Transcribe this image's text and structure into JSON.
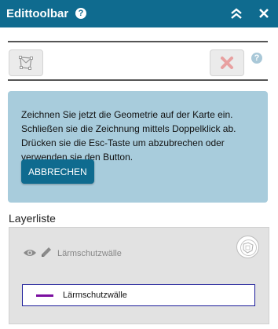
{
  "titlebar": {
    "title": "Edittoolbar",
    "help_glyph": "?",
    "collapse_icon": "double-chevron-up-icon",
    "close_icon": "close-icon"
  },
  "toolbar": {
    "draw_tool_icon": "polygon-draw-icon",
    "cancel_tool_icon": "red-x-icon",
    "help_glyph": "?"
  },
  "info": {
    "text": "Zeichnen Sie jetzt die Geometrie auf der Karte ein. Schließen sie die Zeichnung mittels Doppelklick ab. Drücken sie die Esc-Taste um abzubrechen oder verwenden sie den Button.",
    "button_label": "ABBRECHEN"
  },
  "layers": {
    "heading": "Layerliste",
    "items": [
      {
        "name": "Lärmschutzwälle",
        "legend_label": "Lärmschutzwälle",
        "legend_color": "#7b0fa0"
      }
    ]
  },
  "colors": {
    "accent": "#0f6b8f",
    "info_bg": "#a8ccdc",
    "cancel_red": "#e8a0a0"
  }
}
